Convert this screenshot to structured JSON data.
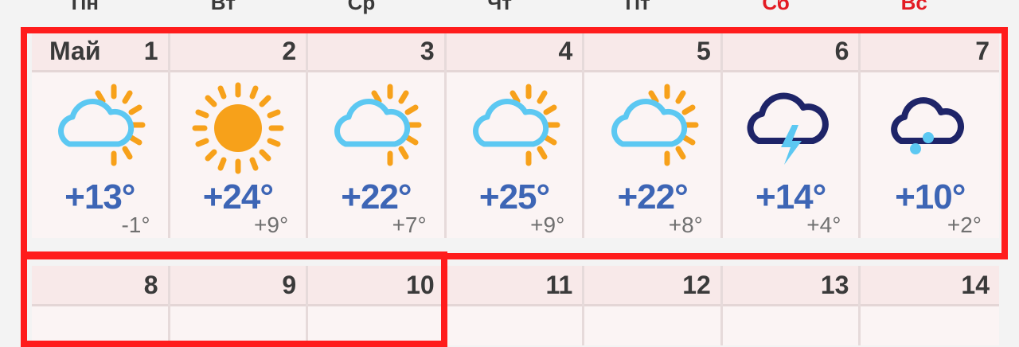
{
  "weekdays": [
    {
      "label": "Пн",
      "weekend": false
    },
    {
      "label": "Вт",
      "weekend": false
    },
    {
      "label": "Ср",
      "weekend": false
    },
    {
      "label": "Чт",
      "weekend": false
    },
    {
      "label": "Пт",
      "weekend": false
    },
    {
      "label": "Сб",
      "weekend": true
    },
    {
      "label": "Вс",
      "weekend": true
    }
  ],
  "week1": [
    {
      "month": "Май",
      "day": "1",
      "icon": "partly-cloudy-icon",
      "hi": "+13°",
      "lo": "-1°"
    },
    {
      "month": "",
      "day": "2",
      "icon": "sunny-icon",
      "hi": "+24°",
      "lo": "+9°"
    },
    {
      "month": "",
      "day": "3",
      "icon": "partly-cloudy-icon",
      "hi": "+22°",
      "lo": "+7°"
    },
    {
      "month": "",
      "day": "4",
      "icon": "partly-cloudy-icon",
      "hi": "+25°",
      "lo": "+9°"
    },
    {
      "month": "",
      "day": "5",
      "icon": "partly-cloudy-icon",
      "hi": "+22°",
      "lo": "+8°"
    },
    {
      "month": "",
      "day": "6",
      "icon": "thunderstorm-icon",
      "hi": "+14°",
      "lo": "+4°"
    },
    {
      "month": "",
      "day": "7",
      "icon": "hail-icon",
      "hi": "+10°",
      "lo": "+2°"
    }
  ],
  "week2": [
    {
      "day": "8"
    },
    {
      "day": "9"
    },
    {
      "day": "10"
    },
    {
      "day": "11"
    },
    {
      "day": "12"
    },
    {
      "day": "13"
    },
    {
      "day": "14"
    }
  ],
  "colors": {
    "highlight": "#ff1c1c",
    "temp_high": "#3d65b5",
    "weekend": "#e31b23",
    "sun": "#f7a11a",
    "cloud_light": "#5cc8f2",
    "cloud_dark": "#1e2468"
  }
}
